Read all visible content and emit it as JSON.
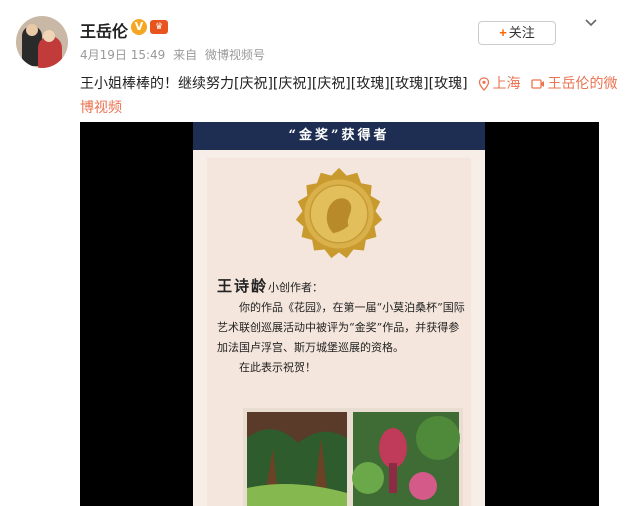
{
  "post": {
    "username": "王岳伦",
    "verified_badge": "V",
    "vip_badge": "👑",
    "time": "4月19日 15:49",
    "source_prefix": "来自",
    "source": "微博视频号",
    "follow_label": "关注",
    "text": "王小姐棒棒的！继续努力[庆祝][庆祝][庆祝][玫瑰][玫瑰][玫瑰]",
    "location": "上海",
    "video_link": "王岳伦的微博视频"
  },
  "poster": {
    "header": "“金奖”获得者",
    "recipient": "王诗龄",
    "recipient_suffix": "小创作者：",
    "body_line1": "你的作品《花园》，在第一届“小莫泊桑杯”国际艺术联创巡展活动中被评为“金奖”作品，并获得参加法国卢浮宫、斯万城堡巡展的资格。",
    "body_line2": "在此表示祝贺！"
  },
  "colors": {
    "accent_link": "#eb7350",
    "poster_header_bg": "#1e2e52",
    "medal_gold": "#d4a73a"
  },
  "icons": [
    "avatar",
    "verified-icon",
    "vip-crown-icon",
    "chevron-down-icon",
    "location-pin-icon",
    "video-icon",
    "gold-medal-icon"
  ]
}
